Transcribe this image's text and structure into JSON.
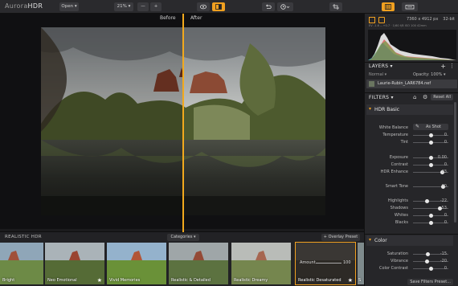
{
  "app": {
    "logo_prefix": "Aurora",
    "logo_suffix": "HDR"
  },
  "toolbar": {
    "open_label": "Open ▾",
    "zoom_label": "21% ▾",
    "zoom_out": "—",
    "zoom_in": "+",
    "image_info": "7360 x 4912 px",
    "bit_depth": "32-bit"
  },
  "compare": {
    "before_label": "Before",
    "after_label": "After"
  },
  "histogram": {
    "exif": "EV -1.6 ...+0.7 · 1/60 f/8 ISO 100 42mm"
  },
  "layers": {
    "title": "LAYERS ▾",
    "blend_mode": "Normal ▾",
    "opacity_label": "Opacity: 100% ▾",
    "layer_name": "Laurie-Rubin_LAR6784.nef"
  },
  "filters": {
    "title": "FILTERS ▾",
    "reset_label": "Reset All",
    "hdr_basic": {
      "title": "HDR Basic",
      "white_balance_label": "White Balance",
      "white_balance_value": "As Shot",
      "sliders": [
        {
          "label": "Temperature",
          "value": "0",
          "pos": 0.5
        },
        {
          "label": "Tint",
          "value": "0",
          "pos": 0.5
        },
        {
          "label": "Exposure",
          "value": "0.00",
          "pos": 0.5
        },
        {
          "label": "Contrast",
          "value": "0",
          "pos": 0.5
        },
        {
          "label": "HDR Enhance",
          "value": "83",
          "pos": 0.83
        },
        {
          "label": "Smart Tone",
          "value": "70",
          "pos": 0.85
        },
        {
          "label": "Highlights",
          "value": "-22",
          "pos": 0.39
        },
        {
          "label": "Shadows",
          "value": "53",
          "pos": 0.76
        },
        {
          "label": "Whites",
          "value": "0",
          "pos": 0.5
        },
        {
          "label": "Blacks",
          "value": "0",
          "pos": 0.5
        }
      ]
    },
    "color": {
      "title": "Color",
      "sliders": [
        {
          "label": "Saturation",
          "value": "-15",
          "pos": 0.42
        },
        {
          "label": "Vibrance",
          "value": "-20",
          "pos": 0.4
        },
        {
          "label": "Color Contrast",
          "value": "0",
          "pos": 0.5
        }
      ]
    },
    "save_label": "Save Filters Preset..."
  },
  "filmstrip": {
    "title": "REALISTIC HDR",
    "categories_label": "Categories ▾",
    "overlay_label": "+ Overlay Preset",
    "amount_label": "Amount",
    "amount_value": "100",
    "presets": [
      {
        "label": "Bright",
        "starred": false
      },
      {
        "label": "Neo Emotional",
        "starred": true
      },
      {
        "label": "Vivid Memories",
        "starred": false
      },
      {
        "label": "Realistic & Detailed",
        "starred": false
      },
      {
        "label": "Realistic Dreamy",
        "starred": false
      },
      {
        "label": "Realistic Desaturated",
        "starred": true,
        "selected": true
      },
      {
        "label": "S",
        "starred": false
      }
    ]
  },
  "colors": {
    "accent": "#f0a020",
    "panel": "#262629",
    "canvas": "#101012"
  }
}
